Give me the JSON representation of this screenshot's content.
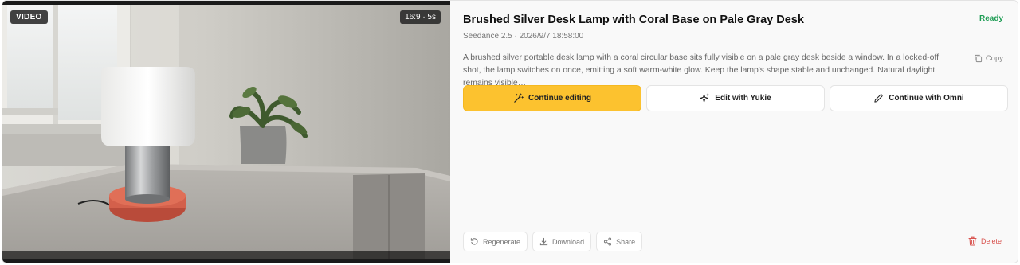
{
  "media": {
    "type_badge": "VIDEO",
    "meta_badge": "16:9 · 5s"
  },
  "panel": {
    "title": "Brushed Silver Desk Lamp with Coral Base on Pale Gray Desk",
    "status": "Ready",
    "status_color": "#1f9d55",
    "meta": "Seedance 2.5 · 2026/9/7 18:58:00",
    "description": "A brushed silver portable desk lamp with a coral circular base sits fully visible on a pale gray desk beside a window. In a locked-off shot, the lamp switches on once, emitting a soft warm-white glow. Keep the lamp's shape stable and unchanged. Natural daylight remains visible…",
    "copy_label": "Copy"
  },
  "actions": {
    "continue_editing": "Continue editing",
    "edit_with_yukie": "Edit with Yukie",
    "continue_with_omni": "Continue with Omni",
    "accent_color": "#fcc22f"
  },
  "footer": {
    "regenerate": "Regenerate",
    "download": "Download",
    "share": "Share",
    "delete": "Delete",
    "delete_color": "#d9534f"
  }
}
